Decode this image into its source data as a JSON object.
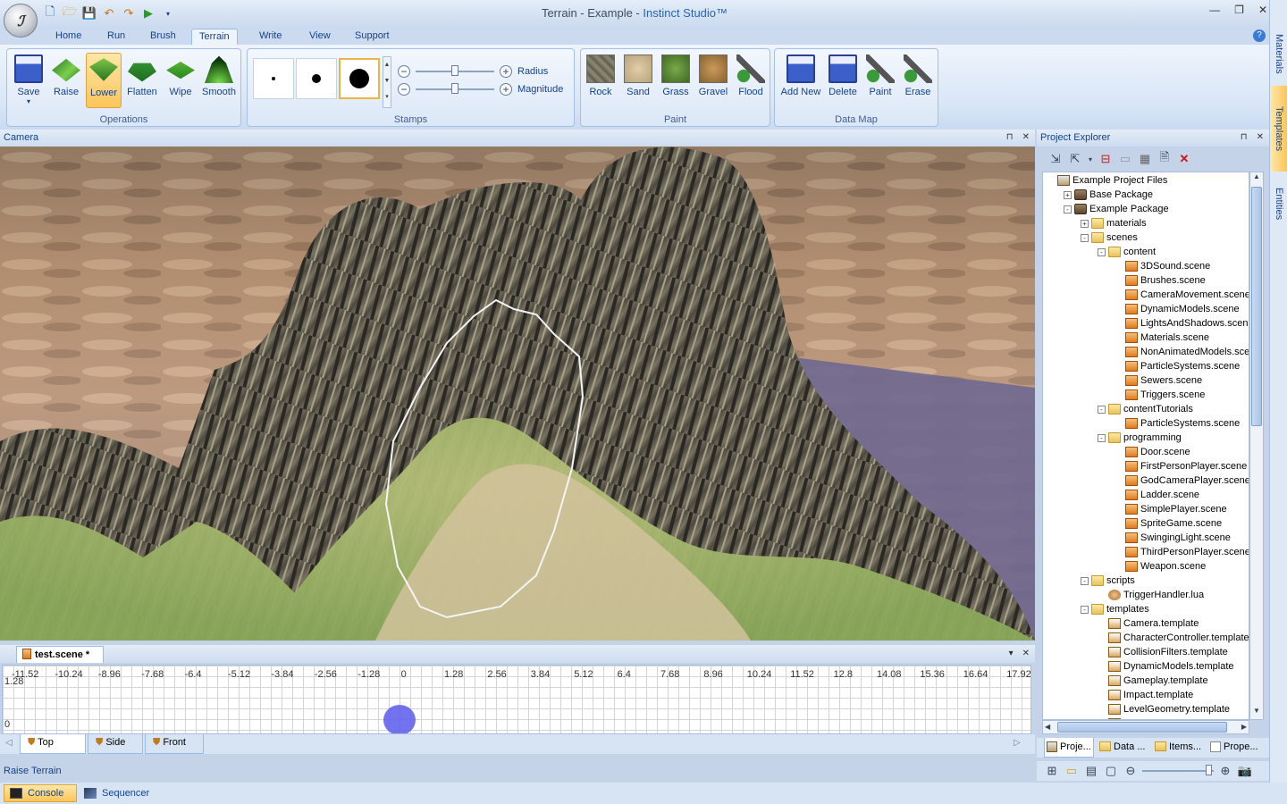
{
  "window": {
    "title_prefix": "Terrain - Example - ",
    "title_brand": "Instinct Studio™",
    "app_logo": "ℐ"
  },
  "quick_access": [
    "new-icon",
    "open-icon",
    "save-icon",
    "undo-icon",
    "redo-icon",
    "play-icon"
  ],
  "ribbon_tabs": [
    "Home",
    "Run",
    "Brush",
    "Terrain",
    "Write",
    "View",
    "Support"
  ],
  "active_tab": "Terrain",
  "ribbon": {
    "operations": {
      "label": "Operations",
      "buttons": [
        "Save",
        "Raise",
        "Lower",
        "Flatten",
        "Wipe",
        "Smooth"
      ],
      "selected": "Lower"
    },
    "stamps": {
      "label": "Stamps",
      "radius_label": "Radius",
      "magnitude_label": "Magnitude",
      "radius_level": 0.5,
      "magnitude_level": 0.5
    },
    "paint": {
      "label": "Paint",
      "buttons": [
        "Rock",
        "Sand",
        "Grass",
        "Gravel",
        "Flood"
      ]
    },
    "data_map": {
      "label": "Data Map",
      "buttons": [
        "Add New",
        "Delete",
        "Paint",
        "Erase"
      ]
    }
  },
  "camera_panel": {
    "title": "Camera"
  },
  "document_tab": {
    "title": "test.scene *"
  },
  "timeline": {
    "ticks": [
      "-11.52",
      "-10.24",
      "-8.96",
      "-7.68",
      "-6.4",
      "-5.12",
      "-3.84",
      "-2.56",
      "-1.28",
      "0",
      "1.28",
      "2.56",
      "3.84",
      "5.12",
      "6.4",
      "7.68",
      "8.96",
      "10.24",
      "11.52",
      "12.8",
      "14.08",
      "15.36",
      "16.64",
      "17.92"
    ],
    "y_top": "1.28",
    "y_bottom": "0"
  },
  "view_tabs": [
    "Top",
    "Side",
    "Front"
  ],
  "active_view_tab": "Top",
  "status": "Raise Terrain",
  "bottom_tabs": [
    "Console",
    "Sequencer"
  ],
  "active_bottom_tab": "Console",
  "project_explorer": {
    "title": "Project Explorer",
    "tree": [
      {
        "label": "Example Project Files",
        "level": 0,
        "kind": "proj",
        "exp": ""
      },
      {
        "label": "Base Package",
        "level": 1,
        "kind": "pkg",
        "exp": "+"
      },
      {
        "label": "Example Package",
        "level": 1,
        "kind": "pkg",
        "exp": "-"
      },
      {
        "label": "materials",
        "level": 2,
        "kind": "folder",
        "exp": "+"
      },
      {
        "label": "scenes",
        "level": 2,
        "kind": "folder",
        "exp": "-"
      },
      {
        "label": "content",
        "level": 3,
        "kind": "folder",
        "exp": "-"
      },
      {
        "label": "3DSound.scene",
        "level": 4,
        "kind": "scene",
        "exp": ""
      },
      {
        "label": "Brushes.scene",
        "level": 4,
        "kind": "scene",
        "exp": ""
      },
      {
        "label": "CameraMovement.scene",
        "level": 4,
        "kind": "scene",
        "exp": ""
      },
      {
        "label": "DynamicModels.scene",
        "level": 4,
        "kind": "scene",
        "exp": ""
      },
      {
        "label": "LightsAndShadows.scene",
        "level": 4,
        "kind": "scene",
        "exp": ""
      },
      {
        "label": "Materials.scene",
        "level": 4,
        "kind": "scene",
        "exp": ""
      },
      {
        "label": "NonAnimatedModels.scene",
        "level": 4,
        "kind": "scene",
        "exp": ""
      },
      {
        "label": "ParticleSystems.scene",
        "level": 4,
        "kind": "scene",
        "exp": ""
      },
      {
        "label": "Sewers.scene",
        "level": 4,
        "kind": "scene",
        "exp": ""
      },
      {
        "label": "Triggers.scene",
        "level": 4,
        "kind": "scene",
        "exp": ""
      },
      {
        "label": "contentTutorials",
        "level": 3,
        "kind": "folder",
        "exp": "-"
      },
      {
        "label": "ParticleSystems.scene",
        "level": 4,
        "kind": "scene",
        "exp": ""
      },
      {
        "label": "programming",
        "level": 3,
        "kind": "folder",
        "exp": "-"
      },
      {
        "label": "Door.scene",
        "level": 4,
        "kind": "scene",
        "exp": ""
      },
      {
        "label": "FirstPersonPlayer.scene",
        "level": 4,
        "kind": "scene",
        "exp": ""
      },
      {
        "label": "GodCameraPlayer.scene",
        "level": 4,
        "kind": "scene",
        "exp": ""
      },
      {
        "label": "Ladder.scene",
        "level": 4,
        "kind": "scene",
        "exp": ""
      },
      {
        "label": "SimplePlayer.scene",
        "level": 4,
        "kind": "scene",
        "exp": ""
      },
      {
        "label": "SpriteGame.scene",
        "level": 4,
        "kind": "scene",
        "exp": ""
      },
      {
        "label": "SwingingLight.scene",
        "level": 4,
        "kind": "scene",
        "exp": ""
      },
      {
        "label": "ThirdPersonPlayer.scene",
        "level": 4,
        "kind": "scene",
        "exp": ""
      },
      {
        "label": "Weapon.scene",
        "level": 4,
        "kind": "scene",
        "exp": ""
      },
      {
        "label": "scripts",
        "level": 2,
        "kind": "folder",
        "exp": "-"
      },
      {
        "label": "TriggerHandler.lua",
        "level": 3,
        "kind": "lua",
        "exp": ""
      },
      {
        "label": "templates",
        "level": 2,
        "kind": "folder",
        "exp": "-"
      },
      {
        "label": "Camera.template",
        "level": 3,
        "kind": "tmpl",
        "exp": ""
      },
      {
        "label": "CharacterController.template",
        "level": 3,
        "kind": "tmpl",
        "exp": ""
      },
      {
        "label": "CollisionFilters.template",
        "level": 3,
        "kind": "tmpl",
        "exp": ""
      },
      {
        "label": "DynamicModels.template",
        "level": 3,
        "kind": "tmpl",
        "exp": ""
      },
      {
        "label": "Gameplay.template",
        "level": 3,
        "kind": "tmpl",
        "exp": ""
      },
      {
        "label": "Impact.template",
        "level": 3,
        "kind": "tmpl",
        "exp": ""
      },
      {
        "label": "LevelGeometry.template",
        "level": 3,
        "kind": "tmpl",
        "exp": ""
      },
      {
        "label": "Markers.template",
        "level": 3,
        "kind": "tmpl",
        "exp": ""
      }
    ],
    "tabs": [
      "Proje...",
      "Data ...",
      "Items...",
      "Prope..."
    ]
  },
  "side_tabs": [
    "Materials",
    "Templates",
    "Entities"
  ],
  "active_side_tab": "Templates"
}
